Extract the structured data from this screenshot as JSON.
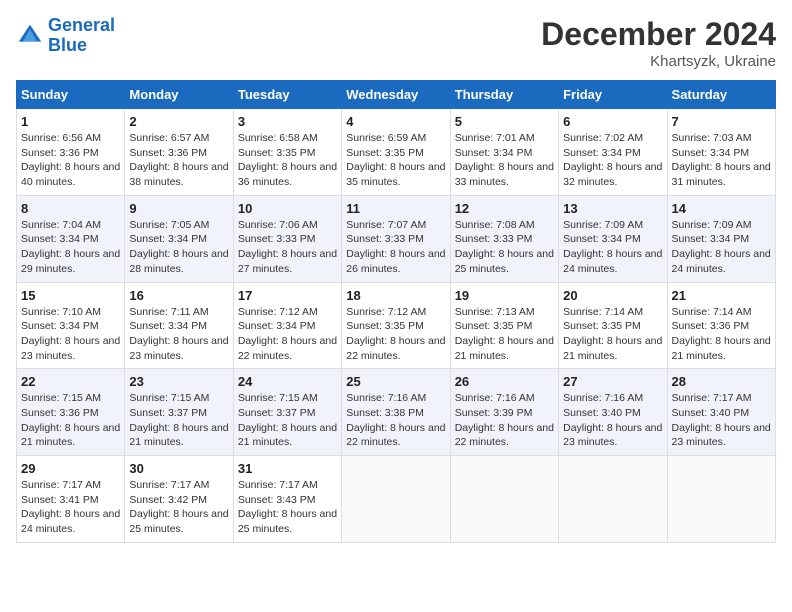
{
  "logo": {
    "line1": "General",
    "line2": "Blue"
  },
  "title": "December 2024",
  "subtitle": "Khartsyzk, Ukraine",
  "weekdays": [
    "Sunday",
    "Monday",
    "Tuesday",
    "Wednesday",
    "Thursday",
    "Friday",
    "Saturday"
  ],
  "weeks": [
    [
      {
        "day": 1,
        "sunrise": "6:56 AM",
        "sunset": "3:36 PM",
        "daylight": "8 hours and 40 minutes."
      },
      {
        "day": 2,
        "sunrise": "6:57 AM",
        "sunset": "3:36 PM",
        "daylight": "8 hours and 38 minutes."
      },
      {
        "day": 3,
        "sunrise": "6:58 AM",
        "sunset": "3:35 PM",
        "daylight": "8 hours and 36 minutes."
      },
      {
        "day": 4,
        "sunrise": "6:59 AM",
        "sunset": "3:35 PM",
        "daylight": "8 hours and 35 minutes."
      },
      {
        "day": 5,
        "sunrise": "7:01 AM",
        "sunset": "3:34 PM",
        "daylight": "8 hours and 33 minutes."
      },
      {
        "day": 6,
        "sunrise": "7:02 AM",
        "sunset": "3:34 PM",
        "daylight": "8 hours and 32 minutes."
      },
      {
        "day": 7,
        "sunrise": "7:03 AM",
        "sunset": "3:34 PM",
        "daylight": "8 hours and 31 minutes."
      }
    ],
    [
      {
        "day": 8,
        "sunrise": "7:04 AM",
        "sunset": "3:34 PM",
        "daylight": "8 hours and 29 minutes."
      },
      {
        "day": 9,
        "sunrise": "7:05 AM",
        "sunset": "3:34 PM",
        "daylight": "8 hours and 28 minutes."
      },
      {
        "day": 10,
        "sunrise": "7:06 AM",
        "sunset": "3:33 PM",
        "daylight": "8 hours and 27 minutes."
      },
      {
        "day": 11,
        "sunrise": "7:07 AM",
        "sunset": "3:33 PM",
        "daylight": "8 hours and 26 minutes."
      },
      {
        "day": 12,
        "sunrise": "7:08 AM",
        "sunset": "3:33 PM",
        "daylight": "8 hours and 25 minutes."
      },
      {
        "day": 13,
        "sunrise": "7:09 AM",
        "sunset": "3:34 PM",
        "daylight": "8 hours and 24 minutes."
      },
      {
        "day": 14,
        "sunrise": "7:09 AM",
        "sunset": "3:34 PM",
        "daylight": "8 hours and 24 minutes."
      }
    ],
    [
      {
        "day": 15,
        "sunrise": "7:10 AM",
        "sunset": "3:34 PM",
        "daylight": "8 hours and 23 minutes."
      },
      {
        "day": 16,
        "sunrise": "7:11 AM",
        "sunset": "3:34 PM",
        "daylight": "8 hours and 23 minutes."
      },
      {
        "day": 17,
        "sunrise": "7:12 AM",
        "sunset": "3:34 PM",
        "daylight": "8 hours and 22 minutes."
      },
      {
        "day": 18,
        "sunrise": "7:12 AM",
        "sunset": "3:35 PM",
        "daylight": "8 hours and 22 minutes."
      },
      {
        "day": 19,
        "sunrise": "7:13 AM",
        "sunset": "3:35 PM",
        "daylight": "8 hours and 21 minutes."
      },
      {
        "day": 20,
        "sunrise": "7:14 AM",
        "sunset": "3:35 PM",
        "daylight": "8 hours and 21 minutes."
      },
      {
        "day": 21,
        "sunrise": "7:14 AM",
        "sunset": "3:36 PM",
        "daylight": "8 hours and 21 minutes."
      }
    ],
    [
      {
        "day": 22,
        "sunrise": "7:15 AM",
        "sunset": "3:36 PM",
        "daylight": "8 hours and 21 minutes."
      },
      {
        "day": 23,
        "sunrise": "7:15 AM",
        "sunset": "3:37 PM",
        "daylight": "8 hours and 21 minutes."
      },
      {
        "day": 24,
        "sunrise": "7:15 AM",
        "sunset": "3:37 PM",
        "daylight": "8 hours and 21 minutes."
      },
      {
        "day": 25,
        "sunrise": "7:16 AM",
        "sunset": "3:38 PM",
        "daylight": "8 hours and 22 minutes."
      },
      {
        "day": 26,
        "sunrise": "7:16 AM",
        "sunset": "3:39 PM",
        "daylight": "8 hours and 22 minutes."
      },
      {
        "day": 27,
        "sunrise": "7:16 AM",
        "sunset": "3:40 PM",
        "daylight": "8 hours and 23 minutes."
      },
      {
        "day": 28,
        "sunrise": "7:17 AM",
        "sunset": "3:40 PM",
        "daylight": "8 hours and 23 minutes."
      }
    ],
    [
      {
        "day": 29,
        "sunrise": "7:17 AM",
        "sunset": "3:41 PM",
        "daylight": "8 hours and 24 minutes."
      },
      {
        "day": 30,
        "sunrise": "7:17 AM",
        "sunset": "3:42 PM",
        "daylight": "8 hours and 25 minutes."
      },
      {
        "day": 31,
        "sunrise": "7:17 AM",
        "sunset": "3:43 PM",
        "daylight": "8 hours and 25 minutes."
      },
      null,
      null,
      null,
      null
    ]
  ]
}
